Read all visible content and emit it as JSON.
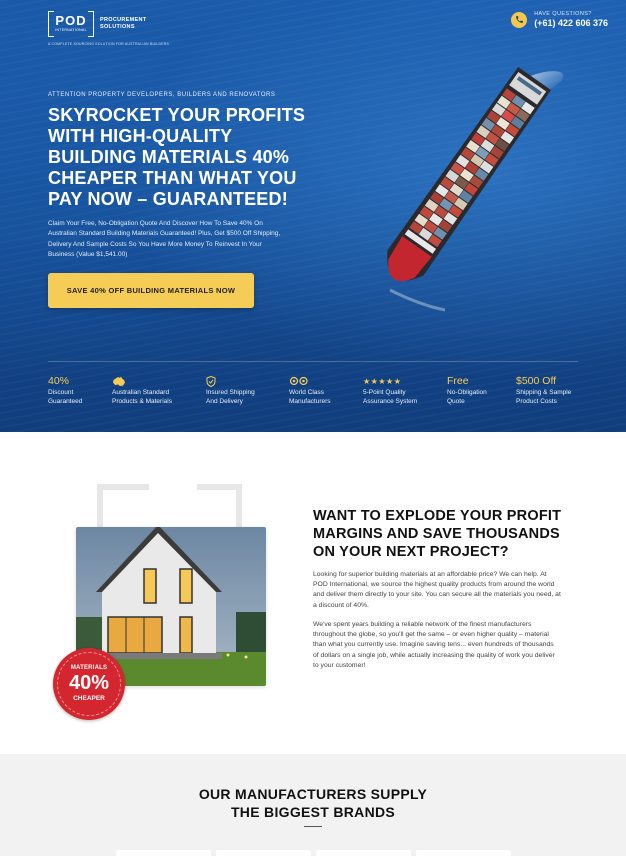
{
  "header": {
    "logo_main": "POD",
    "logo_sub": "INTERNATIONAL",
    "logo_line1": "PROCUREMENT",
    "logo_line2": "SOLUTIONS",
    "logo_tagline": "A COMPLETE SOURCING SOLUTION FOR AUSTRALIAN BUILDERS",
    "contact_label": "HAVE QUESTIONS?",
    "phone": "(+61) 422 606 376",
    "phone_icon": "phone-icon"
  },
  "hero": {
    "eyebrow": "ATTENTION PROPERTY DEVELOPERS, BUILDERS AND RENOVATORS",
    "headline": "SKYROCKET YOUR PROFITS WITH HIGH-QUALITY BUILDING MATERIALS 40% CHEAPER THAN WHAT YOU PAY NOW – GUARANTEED!",
    "subtext": "Claim Your Free, No-Obligation Quote And Discover How To Save 40% On Australian Standard Building Materials Guaranteed! Plus, Get $500 Off Shipping, Delivery And Sample Costs So You Have More Money To Reinvest In Your Business (Value $1,541.00)",
    "cta_label": "SAVE 40% OFF BUILDING MATERIALS NOW"
  },
  "features": [
    {
      "top": "40%",
      "label1": "Discount",
      "label2": "Guaranteed",
      "icon": ""
    },
    {
      "top": "",
      "label1": "Australian Standard",
      "label2": "Products & Materials",
      "icon": "australia-map-icon"
    },
    {
      "top": "",
      "label1": "Insured Shipping",
      "label2": "And Delivery",
      "icon": "shield-icon"
    },
    {
      "top": "",
      "label1": "World Class",
      "label2": "Manufacturers",
      "icon": "gears-icon"
    },
    {
      "top": "★★★★★",
      "label1": "5-Point Quality",
      "label2": "Assurance System",
      "icon": "stars-icon"
    },
    {
      "top": "Free",
      "label1": "No-Obligation",
      "label2": "Quote",
      "icon": ""
    },
    {
      "top": "$500 Off",
      "label1": "Shipping & Sample",
      "label2": "Product Costs",
      "icon": ""
    }
  ],
  "section2": {
    "badge_line1": "MATERIALS",
    "badge_line2": "40%",
    "badge_line3": "CHEAPER",
    "title": "WANT TO EXPLODE YOUR PROFIT MARGINS AND SAVE THOUSANDS ON YOUR NEXT PROJECT?",
    "para1": "Looking for superior building materials at an affordable price? We can help. At POD International, we source the highest quality products from around the world and deliver them directly to your site. You can secure all the materials you need, at a discount of 40%.",
    "para2": "We've spent years building a reliable network of the finest manufacturers throughout the globe, so you'll get the same – or even higher quality – material than what you currently use. Imagine saving tens... even hundreds of thousands of dollars on a single job, while actually increasing the quality of work you deliver to your customer!"
  },
  "section3": {
    "title_line1": "OUR MANUFACTURERS SUPPLY",
    "title_line2": "THE BIGGEST BRANDS"
  },
  "colors": {
    "hero_blue": "#164f99",
    "accent_yellow": "#f5cc55",
    "badge_red": "#d4262f",
    "light_gray": "#f2f2f2"
  }
}
